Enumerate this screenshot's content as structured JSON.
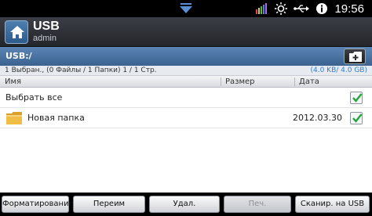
{
  "status_bar": {
    "time": "19:56",
    "icons": [
      "pull-down-tab-icon",
      "signal-bars-icon",
      "brightness-icon",
      "usb-icon",
      "info-icon"
    ]
  },
  "header": {
    "title": "USB",
    "user": "admin"
  },
  "path_bar": {
    "path": "USB:/",
    "new_folder_icon": "new-folder-icon"
  },
  "info_bar": {
    "selection_info": "1 Выбран., (0 Файлы / 1 Папки) 1 / 1 Стр.",
    "storage_info": "(4.0 KB/ 4.0 GB)"
  },
  "columns": {
    "name": "Имя",
    "size": "Размер",
    "date": "Дата"
  },
  "rows": {
    "select_all": {
      "label": "Выбрать все",
      "checked": true
    },
    "folder": {
      "name": "Новая папка",
      "size": "",
      "date": "2012.03.30",
      "checked": true
    }
  },
  "buttons": {
    "format": "Форматирование",
    "rename": "Переим",
    "delete": "Удал.",
    "print": "Печ.",
    "scan": "Сканир. на USB"
  },
  "colors": {
    "path_bar": "#4a74a5",
    "storage_text": "#2f7fd0",
    "check": "#22a53a"
  }
}
